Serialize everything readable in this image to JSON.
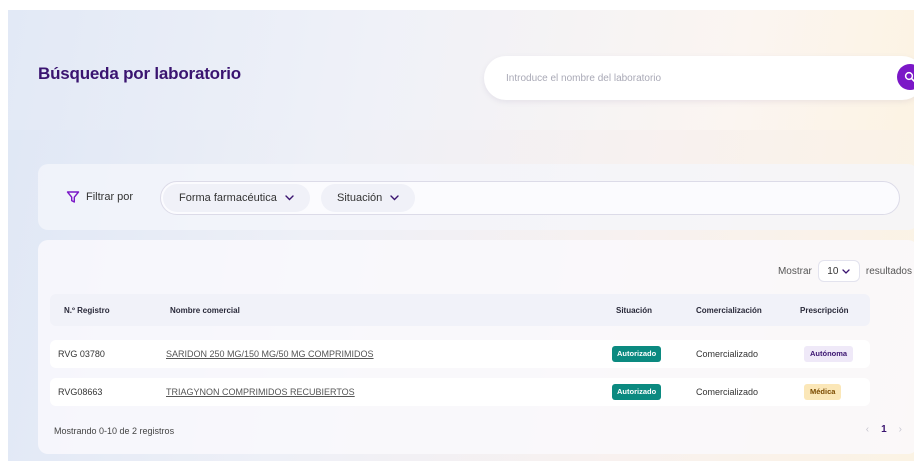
{
  "page": {
    "title": "Búsqueda por laboratorio"
  },
  "search": {
    "placeholder": "Introduce el nombre del laboratorio",
    "button_icon": "search-icon"
  },
  "filters": {
    "label": "Filtrar por",
    "options": [
      {
        "label": "Forma farmacéutica"
      },
      {
        "label": "Situación"
      }
    ]
  },
  "results": {
    "show_label": "Mostrar",
    "page_size": "10",
    "results_label": "resultados",
    "columns": [
      "N.º Registro",
      "Nombre comercial",
      "Situación",
      "Comercialización",
      "Prescripción"
    ],
    "rows": [
      {
        "registro": "RVG 03780",
        "nombre": "SARIDON 250 MG/150 MG/50 MG COMPRIMIDOS",
        "situacion": "Autorizado",
        "comercializacion": "Comercializado",
        "prescripcion": "Autónoma"
      },
      {
        "registro": "RVG08663",
        "nombre": "TRIAGYNON COMPRIMIDOS RECUBIERTOS",
        "situacion": "Autorizado",
        "comercializacion": "Comercializado",
        "prescripcion": "Médica"
      }
    ],
    "footer": "Mostrando 0-10 de 2 registros",
    "pagination": {
      "prev": "‹",
      "current": "1",
      "next": "›"
    }
  },
  "colors": {
    "accent": "#7b17c7",
    "title": "#3a1470",
    "status_authorized": "#0b8a80",
    "rx_autonoma_bg": "#efe9f8",
    "rx_medica_bg": "#fbe7b8"
  }
}
